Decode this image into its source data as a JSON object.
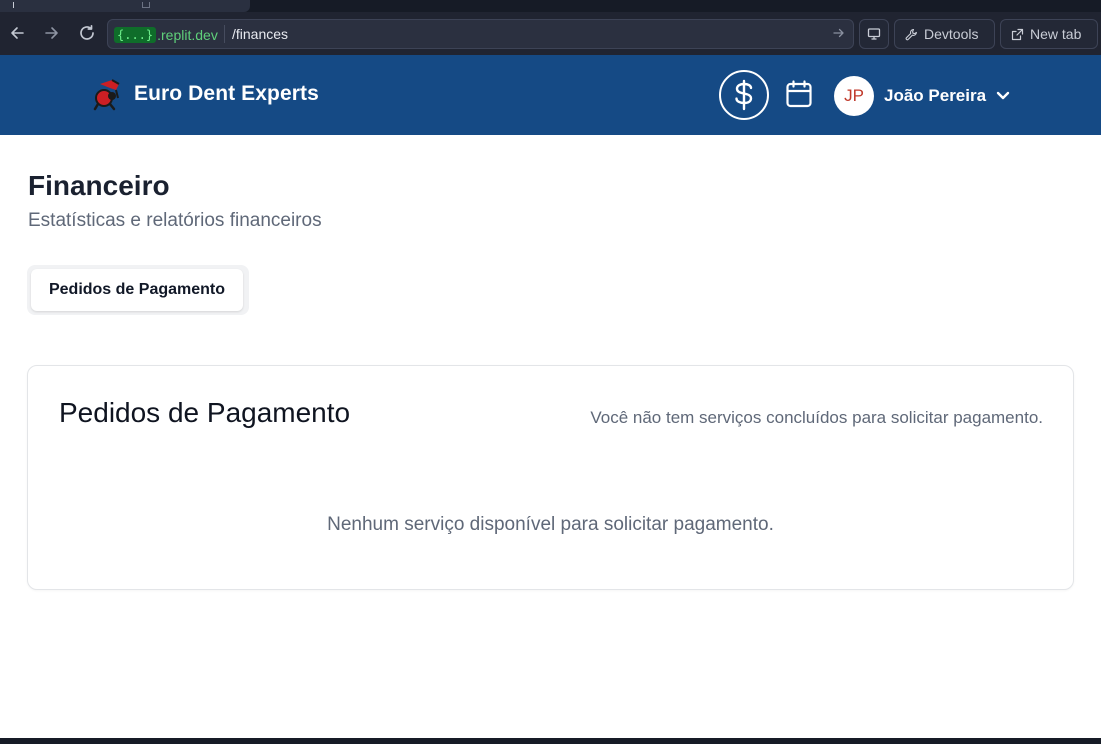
{
  "browser": {
    "back_icon": "arrow-left-icon",
    "forward_icon": "arrow-right-icon",
    "reload_icon": "reload-icon",
    "origin_pill": "{...}",
    "origin_host": ".replit.dev",
    "path": "/finances",
    "devtools_label": "Devtools",
    "newtab_label": "New tab"
  },
  "header": {
    "brand_title": "Euro Dent Experts",
    "finance_icon": "dollar-icon",
    "calendar_icon": "calendar-icon",
    "user": {
      "initials": "JP",
      "name": "João Pereira"
    }
  },
  "page": {
    "title": "Financeiro",
    "subtitle": "Estatísticas e relatórios financeiros",
    "tabs": [
      {
        "label": "Pedidos de Pagamento",
        "active": true
      }
    ]
  },
  "card": {
    "title": "Pedidos de Pagamento",
    "description": "Você não tem serviços concluídos para solicitar pagamento.",
    "empty_message": "Nenhum serviço disponível para solicitar pagamento."
  },
  "colors": {
    "header_bg": "#154a85",
    "avatar_text": "#c0392b",
    "url_origin": "#5fd07a"
  }
}
